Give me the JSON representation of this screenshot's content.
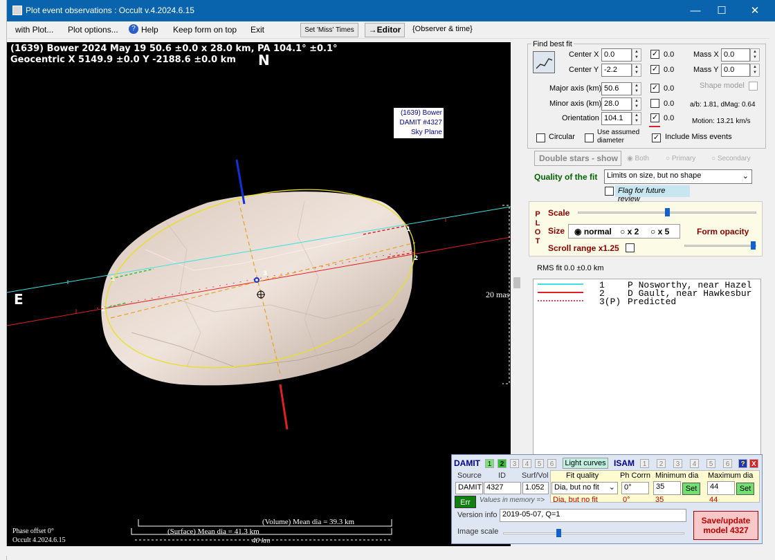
{
  "window": {
    "title": "Plot event observations : Occult v.4.2024.6.15",
    "min": "—",
    "max": "☐",
    "close": "✕"
  },
  "menu": {
    "with_plot": "with Plot...",
    "plot_options": "Plot options...",
    "help": "Help",
    "keep_on_top": "Keep form on top",
    "exit": "Exit",
    "miss_times": "Set 'Miss' Times",
    "editor": "→Editor",
    "observer_time": "{Observer & time}"
  },
  "plot": {
    "header1": "(1639) Bower  2024 May 19   50.6 ±0.0 x 28.0 km,  PA 104.1° ±0.1°",
    "header2": "Geocentric  X  5149.9 ±0.0  Y -2188.6 ±0.0 km",
    "north": "N",
    "east": "E",
    "label_lines": [
      "(1639) Bower",
      "DAMIT #4327",
      "Sky Plane"
    ],
    "scale_label": "20 mas",
    "chord_labels": [
      "1",
      "2",
      "1",
      "2",
      "3"
    ],
    "volume_dia": "(Volume) Mean dia = 39.3 km",
    "surface_dia": "(Surface) Mean dia = 41.3 km",
    "km_scale": "40 km",
    "phase_offset": "Phase offset 0°",
    "version": "Occult 4.2024.6.15"
  },
  "fit": {
    "group_title": "Find best fit",
    "center_x_label": "Center X",
    "center_x": "0.0",
    "center_x_unc": "0.0",
    "center_y_label": "Center Y",
    "center_y": "-2.2",
    "center_y_unc": "0.0",
    "major_label": "Major axis (km)",
    "major": "50.6",
    "major_unc": "0.0",
    "minor_label": "Minor axis (km)",
    "minor": "28.0",
    "minor_unc": "0.0",
    "orient_label": "Orientation",
    "orient": "104.1",
    "orient_unc": "0.0",
    "mass_x_label": "Mass X",
    "mass_x": "0.0",
    "mass_y_label": "Mass Y",
    "mass_y": "0.0",
    "shape_model_label": "Shape model",
    "ab_ratio": "a/b: 1.81, dMag: 0.64",
    "motion": "Motion: 13.21 km/s",
    "circular": "Circular",
    "use_assumed": "Use assumed diameter",
    "include_miss": "Include Miss events",
    "double_stars": "Double stars - show",
    "both": "Both",
    "primary": "Primary",
    "secondary": "Secondary",
    "quality_label": "Quality of the fit",
    "quality_value": "Limits on size, but no shape",
    "flag_review": "Flag for future review"
  },
  "plotpanel": {
    "side": [
      "P",
      "L",
      "O",
      "T"
    ],
    "scale": "Scale",
    "size": "Size",
    "normal": "normal",
    "x2": "x 2",
    "x5": "x 5",
    "form_opacity": "Form opacity",
    "scroll_range": "Scroll range x1.25",
    "scale_level": 0.5,
    "opacity_level": 1.0
  },
  "rms": "RMS fit 0.0 ±0.0 km",
  "legend": [
    {
      "num": "1",
      "text": "P Nosworthy, near Hazel",
      "color": "#40e0e0",
      "style": "solid"
    },
    {
      "num": "2",
      "text": "D Gault, near Hawkesbur",
      "color": "#e02020",
      "style": "solid"
    },
    {
      "num": "3(P)",
      "text": "Predicted",
      "color": "#e04060",
      "style": "dotted"
    }
  ],
  "damit": {
    "title": "DAMIT",
    "tabs": [
      "1",
      "2",
      "3",
      "4",
      "5",
      "6"
    ],
    "light_curves": "Light curves",
    "isam": "ISAM",
    "isam_tabs": [
      "1",
      "2",
      "3",
      "4",
      "5",
      "6"
    ],
    "help": "?",
    "close": "X",
    "source_label": "Source",
    "id_label": "ID",
    "surfvol_label": "Surf/Vol",
    "source": "DAMIT",
    "id": "4327",
    "surfvol": "1.052",
    "fit_quality_label": "Fit quality",
    "fit_quality": "Dia, but no fit",
    "ph_corr_label": "Ph Corrn",
    "ph_corr": "0°",
    "min_dia_label": "Minimum dia",
    "min_dia": "35",
    "max_dia_label": "Maximum dia",
    "max_dia": "44",
    "set": "Set",
    "err": "Err",
    "values_memory": "Values in memory =>",
    "mem_fit": "Dia, but no fit",
    "mem_ph": "0°",
    "mem_min": "35",
    "mem_max": "44",
    "version_label": "Version info",
    "version": "2019-05-07, Q=1",
    "image_scale": "Image scale",
    "image_scale_level": 0.3,
    "save": "Save/update model 4327"
  },
  "colors": {
    "titlebar": "#0a64ad",
    "chord1": "#40e0e0",
    "chord2": "#e02020",
    "ellipse": "#e8e020",
    "damit_bg": "#dde6f2",
    "save_bg": "#f8c8c8"
  }
}
